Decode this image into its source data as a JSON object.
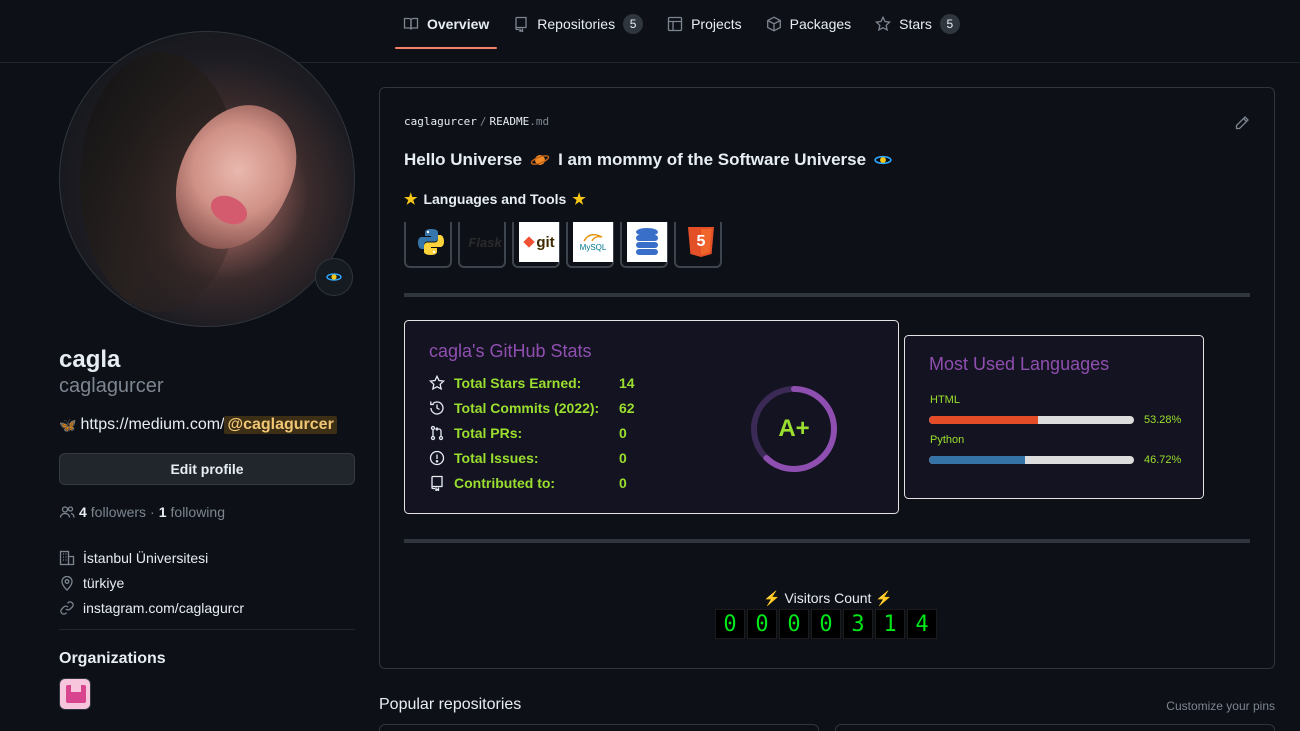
{
  "tabs": [
    {
      "label": "Overview",
      "icon": "book-icon",
      "active": true
    },
    {
      "label": "Repositories",
      "icon": "repo-icon",
      "count": "5"
    },
    {
      "label": "Projects",
      "icon": "table-icon"
    },
    {
      "label": "Packages",
      "icon": "package-icon"
    },
    {
      "label": "Stars",
      "icon": "star-icon",
      "count": "5"
    }
  ],
  "profile": {
    "name": "cagla",
    "login": "caglagurcer",
    "bio_emoji": "🦋",
    "bio_prefix": "https://medium.com/",
    "bio_mention": "@caglagurcer",
    "edit_label": "Edit profile",
    "followers_count": "4",
    "followers_label": "followers",
    "dot": "·",
    "following_count": "1",
    "following_label": "following",
    "company": "İstanbul Üniversitesi",
    "location": "türkiye",
    "website": "instagram.com/caglagurcr",
    "orgs_title": "Organizations"
  },
  "readme": {
    "crumb_user": "caglagurcer",
    "crumb_sep": "/",
    "crumb_file": "README",
    "crumb_ext": ".md",
    "hello_part1": "Hello Universe",
    "hello_part2": "I am mommy of the Software Universe",
    "langs_title": "Languages and Tools",
    "tools": [
      "python-logo",
      "flask-logo",
      "git-logo",
      "mysql-logo",
      "database-logo",
      "html5-logo"
    ],
    "tool_texts": {
      "git": "git",
      "mysql": "MySQL",
      "flask": "Flask",
      "html": "5"
    },
    "stats": {
      "title": "cagla's GitHub Stats",
      "rows": [
        {
          "label": "Total Stars Earned:",
          "value": "14",
          "icon": "star-outline-icon"
        },
        {
          "label": "Total Commits (2022):",
          "value": "62",
          "icon": "history-icon"
        },
        {
          "label": "Total PRs:",
          "value": "0",
          "icon": "pull-request-icon"
        },
        {
          "label": "Total Issues:",
          "value": "0",
          "icon": "issue-icon"
        },
        {
          "label": "Contributed to:",
          "value": "0",
          "icon": "repo-icon"
        }
      ],
      "grade": "A+",
      "ring_fraction": 0.62
    },
    "languages": {
      "title": "Most Used Languages",
      "items": [
        {
          "name": "HTML",
          "percent": "53.28%",
          "fraction": 0.5328,
          "color": "#e34c26"
        },
        {
          "name": "Python",
          "percent": "46.72%",
          "fraction": 0.4672,
          "color": "#3572A5"
        }
      ]
    },
    "visitors_label": "Visitors Count",
    "visitors_digits": [
      "0",
      "0",
      "0",
      "0",
      "3",
      "1",
      "4"
    ]
  },
  "popular": {
    "title": "Popular repositories",
    "customize": "Customize your pins"
  },
  "colors": {
    "accent": "#f78166",
    "stats_title": "#8f4fb0",
    "stats_text": "#9adf2f",
    "bg": "#0d1117"
  }
}
